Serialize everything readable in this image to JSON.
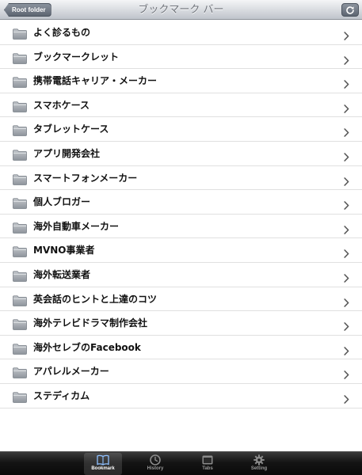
{
  "header": {
    "back_label": "Root folder",
    "title": "ブックマーク バー",
    "refresh_icon": "refresh-icon"
  },
  "bookmarks": [
    {
      "label": "よく診るもの"
    },
    {
      "label": "ブックマークレット"
    },
    {
      "label": "携帯電話キャリア・メーカー"
    },
    {
      "label": "スマホケース"
    },
    {
      "label": "タブレットケース"
    },
    {
      "label": "アプリ開発会社"
    },
    {
      "label": "スマートフォンメーカー"
    },
    {
      "label": "個人ブロガー"
    },
    {
      "label": "海外自動車メーカー"
    },
    {
      "label": "MVNO事業者"
    },
    {
      "label": "海外転送業者"
    },
    {
      "label": "英会話のヒントと上達のコツ"
    },
    {
      "label": "海外テレビドラマ制作会社"
    },
    {
      "label": "海外セレブのFacebook"
    },
    {
      "label": "アパレルメーカー"
    },
    {
      "label": "ステディカム"
    }
  ],
  "tabbar": {
    "tabs": [
      {
        "label": "Bookmark",
        "icon": "book-icon",
        "active": true
      },
      {
        "label": "History",
        "icon": "clock-icon",
        "active": false
      },
      {
        "label": "Tabs",
        "icon": "tabs-icon",
        "active": false
      },
      {
        "label": "Setting",
        "icon": "gear-icon",
        "active": false
      }
    ]
  },
  "colors": {
    "navbar": "#d7dadf",
    "tabbar": "#141414",
    "row_separator": "#e0e0e0"
  }
}
